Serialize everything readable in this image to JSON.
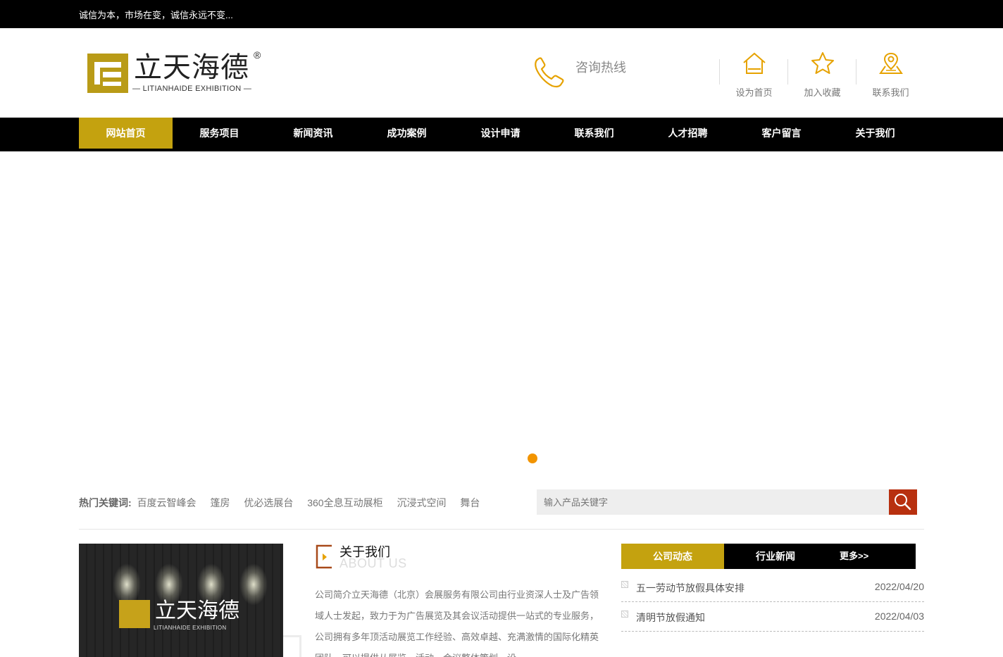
{
  "topbar": {
    "slogan": "诚信为本，市场在变，诚信永远不变..."
  },
  "logo": {
    "cn": "立天海德",
    "reg": "®",
    "en": "— LITIANHAIDE EXHIBITION —"
  },
  "header": {
    "hotline_label": "咨询热线",
    "quick_links": [
      {
        "label": "设为首页",
        "icon": "home-icon"
      },
      {
        "label": "加入收藏",
        "icon": "star-icon"
      },
      {
        "label": "联系我们",
        "icon": "location-icon"
      }
    ]
  },
  "nav": {
    "items": [
      "网站首页",
      "服务项目",
      "新闻资讯",
      "成功案例",
      "设计申请",
      "联系我们",
      "人才招聘",
      "客户留言",
      "关于我们"
    ],
    "active_index": 0
  },
  "hot_keywords": {
    "label": "热门关键词:",
    "items": [
      "百度云智峰会",
      "篷房",
      "优必选展台",
      "360全息互动展柜",
      "沉浸式空间",
      "舞台"
    ]
  },
  "search": {
    "placeholder": "输入产品关键字"
  },
  "about": {
    "image_text_cn": "立天海德",
    "image_text_en": "LITIANHAIDE EXHIBITION",
    "title": "关于我们",
    "subtitle": "ABOUT US",
    "text": "公司简介立天海德（北京）会展服务有限公司由行业资深人士及广告领域人士发起，致力于为广告展览及其会议活动提供一站式的专业服务，公司拥有多年顶活动展览工作经验、高效卓越、充满激情的国际化精英团队，可以提供从展览、活动、会议整体策划、设"
  },
  "news": {
    "tabs": [
      "公司动态",
      "行业新闻"
    ],
    "more": "更多>>",
    "items": [
      {
        "title": "五一劳动节放假具体安排",
        "date": "2022/04/20"
      },
      {
        "title": "清明节放假通知",
        "date": "2022/04/03"
      }
    ]
  },
  "colors": {
    "accent_gold": "#c4a20f",
    "search_red": "#b8300f",
    "dot_orange": "#f29400",
    "black": "#000000"
  }
}
